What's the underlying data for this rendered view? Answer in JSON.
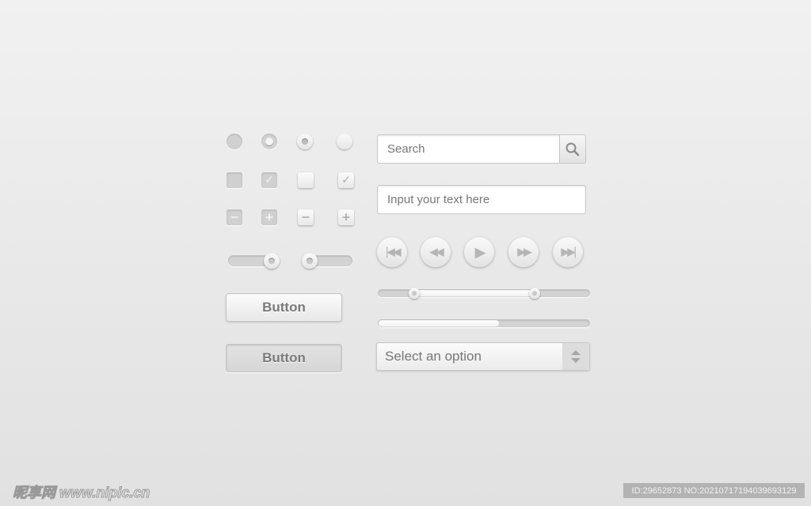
{
  "radios": [
    {
      "state": "unchecked-sunken"
    },
    {
      "state": "checked-sunken"
    },
    {
      "state": "checked-raised"
    },
    {
      "state": "unchecked-raised"
    }
  ],
  "checkboxes": [
    {
      "state": "unchecked-sunken"
    },
    {
      "state": "checked-sunken",
      "icon": "check-icon"
    },
    {
      "state": "unchecked-raised"
    },
    {
      "state": "checked-raised",
      "icon": "check-icon"
    }
  ],
  "steppers": [
    {
      "symbol": "−",
      "icon": "minus-icon"
    },
    {
      "symbol": "+",
      "icon": "plus-icon"
    },
    {
      "symbol": "−",
      "icon": "minus-icon"
    },
    {
      "symbol": "+",
      "icon": "plus-icon"
    }
  ],
  "sliders": [
    {
      "value_percent": 88
    },
    {
      "value_percent": 12
    }
  ],
  "buttons": [
    {
      "label": "Button",
      "state": "normal"
    },
    {
      "label": "Button",
      "state": "pressed"
    }
  ],
  "search": {
    "placeholder": "Search",
    "icon": "search-icon"
  },
  "text_input": {
    "placeholder": "Input your text here"
  },
  "media": [
    {
      "icon": "skip-back-icon",
      "glyph": "|◀◀"
    },
    {
      "icon": "rewind-icon",
      "glyph": "◀◀"
    },
    {
      "icon": "play-icon",
      "glyph": "▶"
    },
    {
      "icon": "fast-forward-icon",
      "glyph": "▶▶"
    },
    {
      "icon": "skip-forward-icon",
      "glyph": "▶▶|"
    }
  ],
  "range_slider": {
    "low_percent": 17,
    "high_percent": 74
  },
  "progress": {
    "value_percent": 57
  },
  "select": {
    "value": "Select an option"
  },
  "watermark": {
    "logo": "昵享网 www.nipic.cn",
    "id": "ID:29652873 NO:20210717194039693129"
  }
}
